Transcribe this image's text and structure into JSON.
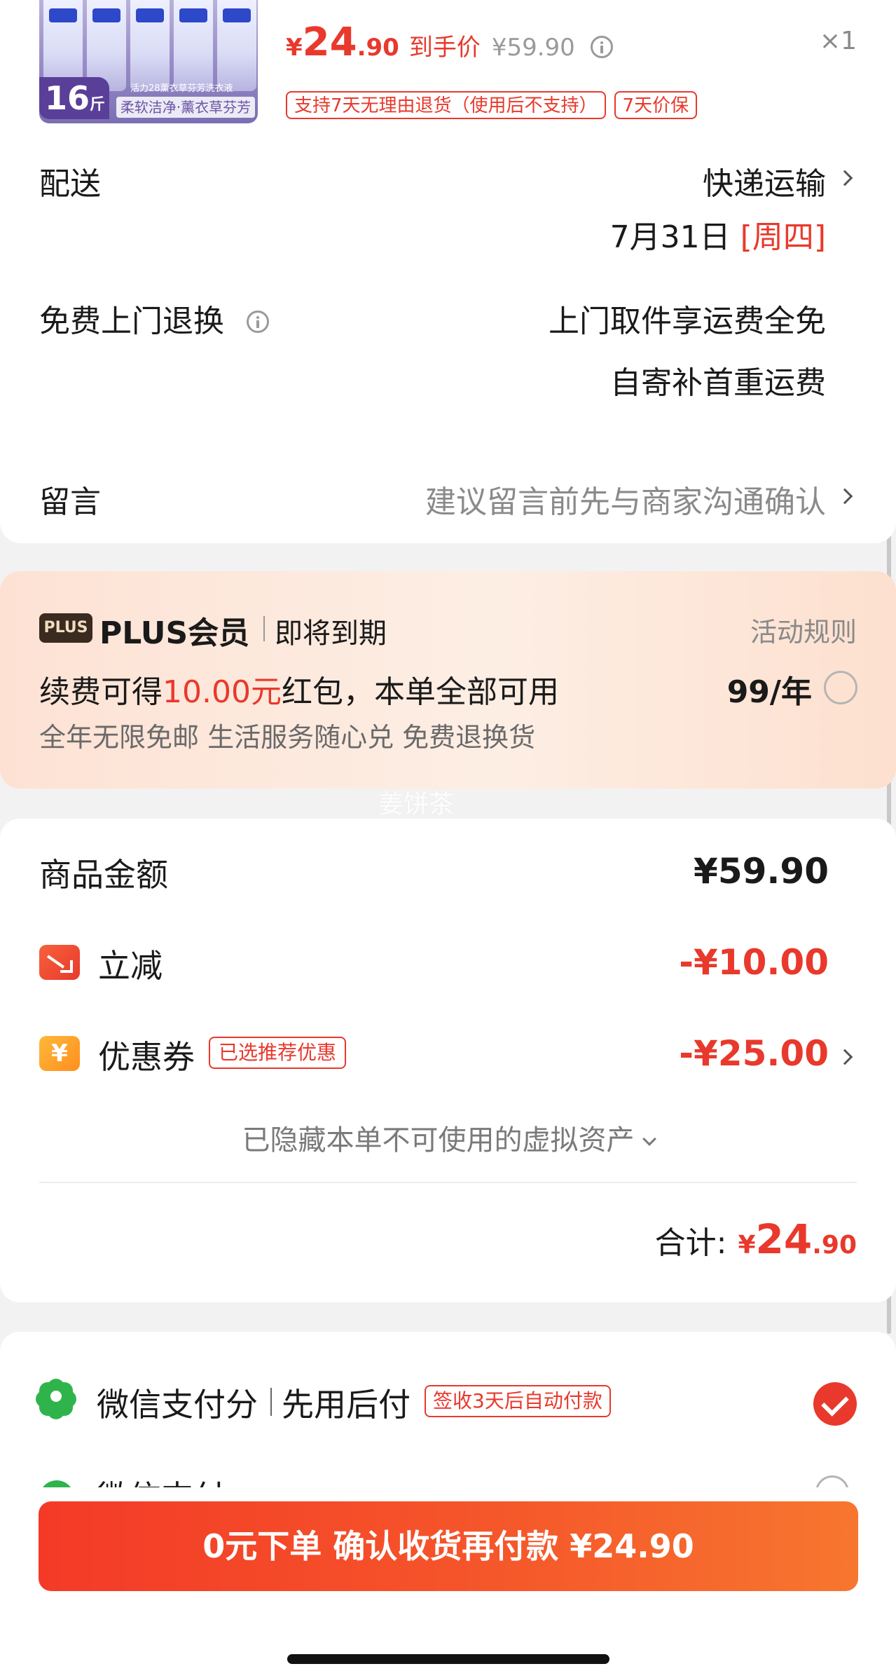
{
  "product": {
    "image_weight": "16",
    "image_weight_unit": "斤",
    "image_slogan": "柔软洁净·薰衣草芬芳",
    "image_small": "活力28薰衣草芬芳洗衣液",
    "price_currency": "¥",
    "price_int": "24",
    "price_dec": ".90",
    "price_label": "到手价",
    "original_price": "¥59.90",
    "quantity": "×1",
    "tags": [
      "支持7天无理由退货（使用后不支持）",
      "7天价保"
    ]
  },
  "delivery": {
    "label": "配送",
    "method": "快递运输",
    "date": "7月31日",
    "weekday": "[周四]"
  },
  "return_service": {
    "label": "免费上门退换",
    "line1": "上门取件享运费全免",
    "line2": "自寄补首重运费"
  },
  "message": {
    "label": "留言",
    "placeholder": "建议留言前先与商家沟通确认"
  },
  "plus": {
    "badge": "PLUS",
    "title": "PLUS会员",
    "subtitle": "即将到期",
    "rules": "活动规则",
    "line1_prefix": "续费可得",
    "line1_amount": "10.00元",
    "line1_suffix": "红包，本单全部可用",
    "price": "99/年",
    "line2": "全年无限免邮 生活服务随心兑 免费退换货"
  },
  "watermark": "姜饼茶",
  "amounts": {
    "goods_label": "商品金额",
    "goods_value": "¥59.90",
    "discount_label": "立减",
    "discount_value": "-¥10.00",
    "coupon_label": "优惠券",
    "coupon_tag": "已选推荐优惠",
    "coupon_value": "-¥25.00",
    "hidden_note": "已隐藏本单不可使用的虚拟资产",
    "total_label": "合计:",
    "total_currency": "¥",
    "total_int": "24",
    "total_dec": ".90"
  },
  "payment": {
    "score_title": "微信支付分",
    "score_sub": "先用后付",
    "score_tag": "签收3天后自动付款",
    "wechat_label": "微信支付"
  },
  "submit_label": "0元下单 确认收货再付款 ¥24.90",
  "colors": {
    "accent": "#e8392c",
    "wechat_green": "#2fb44c",
    "plus_bg": "#fde2d4"
  }
}
